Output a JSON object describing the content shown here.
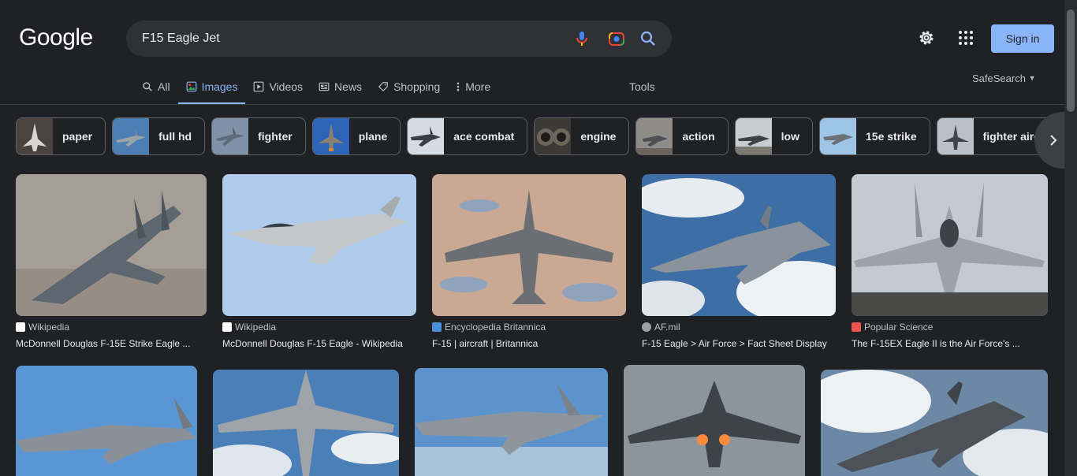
{
  "logo": "Google",
  "search": {
    "query": "F15 Eagle Jet",
    "mic_icon": "mic-icon",
    "lens_icon": "camera-lens-icon",
    "search_icon": "search-icon"
  },
  "header": {
    "settings_icon": "gear-icon",
    "apps_icon": "apps-grid-icon",
    "signin_label": "Sign in"
  },
  "tabs": [
    {
      "label": "All",
      "icon": "search-icon"
    },
    {
      "label": "Images",
      "icon": "image-icon",
      "active": true
    },
    {
      "label": "Videos",
      "icon": "play-icon"
    },
    {
      "label": "News",
      "icon": "news-icon"
    },
    {
      "label": "Shopping",
      "icon": "tag-icon"
    },
    {
      "label": "More",
      "icon": "dots-vertical-icon"
    }
  ],
  "tools_label": "Tools",
  "safesearch_label": "SafeSearch",
  "chips": [
    "paper",
    "full hd",
    "fighter",
    "plane",
    "ace combat",
    "engine",
    "action",
    "low",
    "15e strike",
    "fighter aircraft"
  ],
  "results": [
    {
      "source": "Wikipedia",
      "title": "McDonnell Douglas F-15E Strike Eagle ...",
      "fav_color": "#ffffff"
    },
    {
      "source": "Wikipedia",
      "title": "McDonnell Douglas F-15 Eagle - Wikipedia",
      "fav_color": "#ffffff"
    },
    {
      "source": "Encyclopedia Britannica",
      "title": "F-15 | aircraft | Britannica",
      "fav_color": "#4a90d9"
    },
    {
      "source": "AF.mil",
      "title": "F-15 Eagle > Air Force > Fact Sheet Display",
      "fav_color": "#9aa0a6"
    },
    {
      "source": "Popular Science",
      "title": "The F-15EX Eagle II is the Air Force's ...",
      "fav_color": "#e8554e"
    }
  ],
  "colors": {
    "accent": "#8ab4f8",
    "background": "#202124",
    "surface": "#303134"
  }
}
